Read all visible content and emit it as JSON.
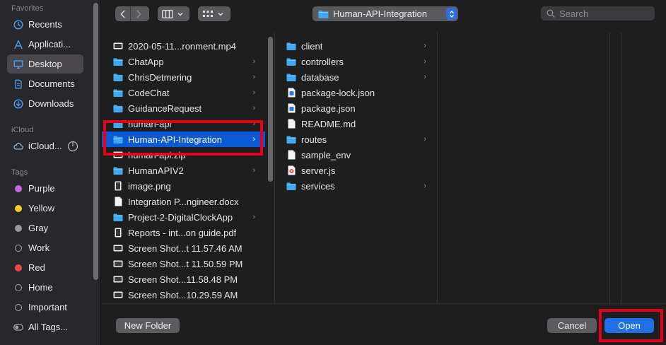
{
  "sidebar": {
    "favorites_header": "Favorites",
    "favorites": [
      {
        "label": "Recents",
        "icon": "clock-icon"
      },
      {
        "label": "Applicati...",
        "icon": "apps-icon"
      },
      {
        "label": "Desktop",
        "icon": "desktop-icon",
        "selected": true
      },
      {
        "label": "Documents",
        "icon": "document-icon"
      },
      {
        "label": "Downloads",
        "icon": "download-icon"
      }
    ],
    "icloud_header": "iCloud",
    "icloud_item": {
      "label": "iCloud...",
      "icon": "cloud-icon"
    },
    "tags_header": "Tags",
    "tags": [
      {
        "label": "Purple",
        "color": "#c466e0"
      },
      {
        "label": "Yellow",
        "color": "#f6cc25"
      },
      {
        "label": "Gray",
        "color": "#9a9a9a"
      },
      {
        "label": "Work",
        "color": ""
      },
      {
        "label": "Red",
        "color": "#ee4a43"
      },
      {
        "label": "Home",
        "color": ""
      },
      {
        "label": "Important",
        "color": ""
      },
      {
        "label": "All Tags...",
        "color": ""
      }
    ]
  },
  "toolbar": {
    "location_label": "Human-API-Integration",
    "search_placeholder": "Search"
  },
  "columns": {
    "col1": [
      {
        "label": "2020-05-11...ronment.mp4",
        "icon": "video-file-icon",
        "folder": false
      },
      {
        "label": "ChatApp",
        "icon": "folder-icon",
        "folder": true
      },
      {
        "label": "ChrisDetmering",
        "icon": "folder-icon",
        "folder": true
      },
      {
        "label": "CodeChat",
        "icon": "folder-icon",
        "folder": true
      },
      {
        "label": "GuidanceRequest",
        "icon": "folder-icon",
        "folder": true
      },
      {
        "label": "human-api",
        "icon": "folder-icon",
        "folder": true
      },
      {
        "label": "Human-API-Integration",
        "icon": "folder-icon",
        "folder": true,
        "selected": true
      },
      {
        "label": "human-api.zip",
        "icon": "zip-file-icon",
        "folder": false
      },
      {
        "label": "HumanAPIV2",
        "icon": "folder-icon",
        "folder": true
      },
      {
        "label": "image.png",
        "icon": "image-file-icon",
        "folder": false
      },
      {
        "label": "Integration P...ngineer.docx",
        "icon": "doc-file-icon",
        "folder": false
      },
      {
        "label": "Project-2-DigitalClockApp",
        "icon": "folder-icon",
        "folder": true
      },
      {
        "label": "Reports - int...on guide.pdf",
        "icon": "pdf-file-icon",
        "folder": false
      },
      {
        "label": "Screen Shot...t 11.57.46 AM",
        "icon": "screenshot-file-icon",
        "folder": false
      },
      {
        "label": "Screen Shot...t 11.50.59 PM",
        "icon": "screenshot-file-icon",
        "folder": false
      },
      {
        "label": "Screen Shot...11.58.48 PM",
        "icon": "screenshot-file-icon",
        "folder": false
      },
      {
        "label": "Screen Shot...10.29.59 AM",
        "icon": "screenshot-file-icon",
        "folder": false
      }
    ],
    "col2": [
      {
        "label": "client",
        "icon": "folder-icon",
        "folder": true
      },
      {
        "label": "controllers",
        "icon": "folder-icon",
        "folder": true
      },
      {
        "label": "database",
        "icon": "folder-icon",
        "folder": true
      },
      {
        "label": "package-lock.json",
        "icon": "json-file-icon",
        "folder": false
      },
      {
        "label": "package.json",
        "icon": "json-file-icon",
        "folder": false
      },
      {
        "label": "README.md",
        "icon": "text-file-icon",
        "folder": false
      },
      {
        "label": "routes",
        "icon": "folder-icon",
        "folder": true
      },
      {
        "label": "sample_env",
        "icon": "text-file-icon",
        "folder": false
      },
      {
        "label": "server.js",
        "icon": "js-file-icon",
        "folder": false
      },
      {
        "label": "services",
        "icon": "folder-icon",
        "folder": true
      }
    ]
  },
  "footer": {
    "new_folder_label": "New Folder",
    "cancel_label": "Cancel",
    "open_label": "Open"
  },
  "colors": {
    "accent": "#0a5ad6",
    "folder": "#41a8ef",
    "highlight": "#e3001b"
  }
}
